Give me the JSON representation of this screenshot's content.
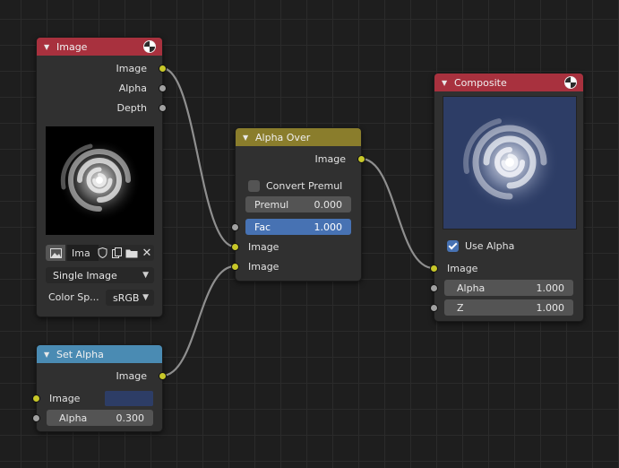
{
  "image_node": {
    "title": "Image",
    "outputs": [
      "Image",
      "Alpha",
      "Depth"
    ],
    "image_name": "Ima",
    "source": "Single Image",
    "color_space_label": "Color Sp...",
    "color_space_value": "sRGB"
  },
  "alpha_over_node": {
    "title": "Alpha Over",
    "output": "Image",
    "convert_premul_label": "Convert Premul",
    "convert_premul_checked": false,
    "premul_label": "Premul",
    "premul_value": "0.000",
    "fac_label": "Fac",
    "fac_value": "1.000",
    "inputs": [
      "Image",
      "Image"
    ]
  },
  "composite_node": {
    "title": "Composite",
    "use_alpha_label": "Use Alpha",
    "use_alpha_checked": true,
    "image_input": "Image",
    "alpha_label": "Alpha",
    "alpha_value": "1.000",
    "z_label": "Z",
    "z_value": "1.000"
  },
  "set_alpha_node": {
    "title": "Set Alpha",
    "output": "Image",
    "image_input": "Image",
    "alpha_label": "Alpha",
    "alpha_value": "0.300"
  },
  "colors": {
    "background": "#1e1e1e",
    "node_body": "#303030",
    "image_header": "#a8313e",
    "alpha_over_header": "#8a7d2c",
    "set_alpha_header": "#4a8bb3",
    "socket_color": "#c7c729",
    "socket_float": "#a1a1a1",
    "active_field": "#4772b3",
    "composite_preview_bg": "#2d3d66"
  }
}
